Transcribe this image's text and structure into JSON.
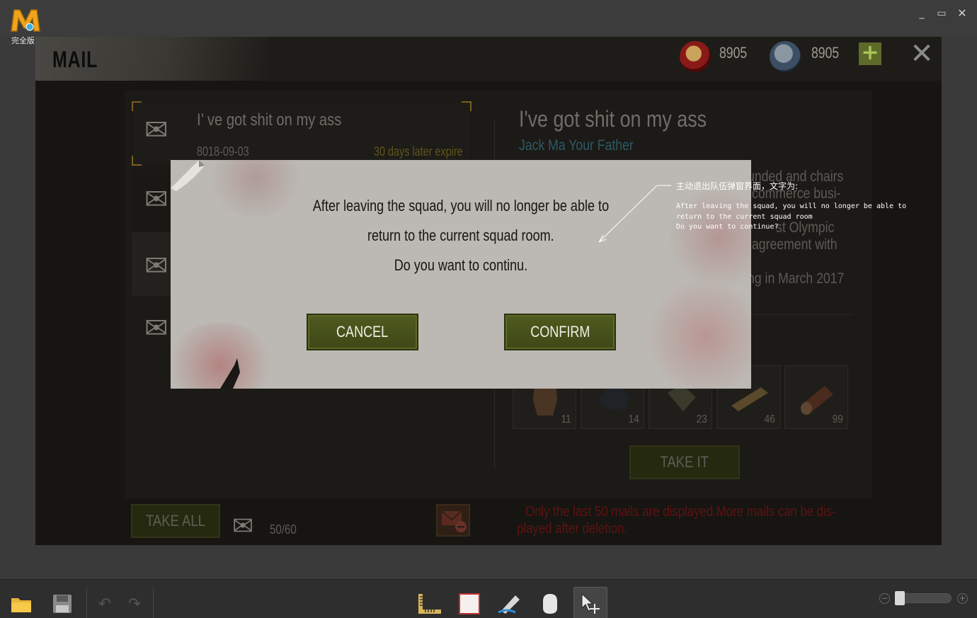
{
  "app": {
    "logo_letter": "M",
    "logo_text": "完全版",
    "window_controls": [
      "minimize-icon",
      "maximize-icon",
      "close-icon"
    ]
  },
  "game": {
    "title": "MAIL",
    "currency_red": "8905",
    "currency_blue": "8905",
    "mail_list": [
      {
        "subject": "I’ ve got shit on my ass",
        "date": "8018-09-03",
        "expire": "30 days later expire",
        "selected": true
      }
    ],
    "detail": {
      "title": "I've got shit on my ass",
      "sender": "Jack Ma Your Father",
      "body_fragments": [
        "unded and chairs",
        "commerce busi-",
        "st Olympic",
        "agreement with",
        "ng in March 2017"
      ]
    },
    "items": [
      {
        "icon": "leather-icon",
        "count": "11"
      },
      {
        "icon": "coal-icon",
        "count": "14"
      },
      {
        "icon": "cloth-icon",
        "count": "23"
      },
      {
        "icon": "plank-icon",
        "count": "46"
      },
      {
        "icon": "log-icon",
        "count": "99"
      }
    ],
    "take_it": "TAKE IT",
    "take_all": "TAKE ALL",
    "mail_count": "50/60",
    "warning_line1": "Only the last 50 mails are displayed.More mails can be dis-",
    "warning_line2": "played after deletion.",
    "colors": {
      "accent_green": "#4f5a1f",
      "warning_red": "#8a1616",
      "link_teal": "#2f6f7a"
    }
  },
  "dialog": {
    "line1": "After leaving the squad, you will no longer be able to",
    "line2": "return to the current squad room.",
    "line3": "Do you want to continu.",
    "cancel": "CANCEL",
    "confirm": "CONFIRM"
  },
  "annotation": {
    "heading": "主动退出队伍弹窗界面，文字为:",
    "line1": "After leaving the squad, you will no longer be able to",
    "line2": "return to the current squad room",
    "line3": "Do you want to continue?"
  },
  "toolbar": {
    "tools": [
      "open-folder-icon",
      "save-icon",
      "undo-icon",
      "redo-icon",
      "ruler-icon",
      "rectangle-icon",
      "pen-icon",
      "eraser-icon",
      "move-icon"
    ],
    "active_tool": "move-icon",
    "zoom_level": 0.0
  }
}
